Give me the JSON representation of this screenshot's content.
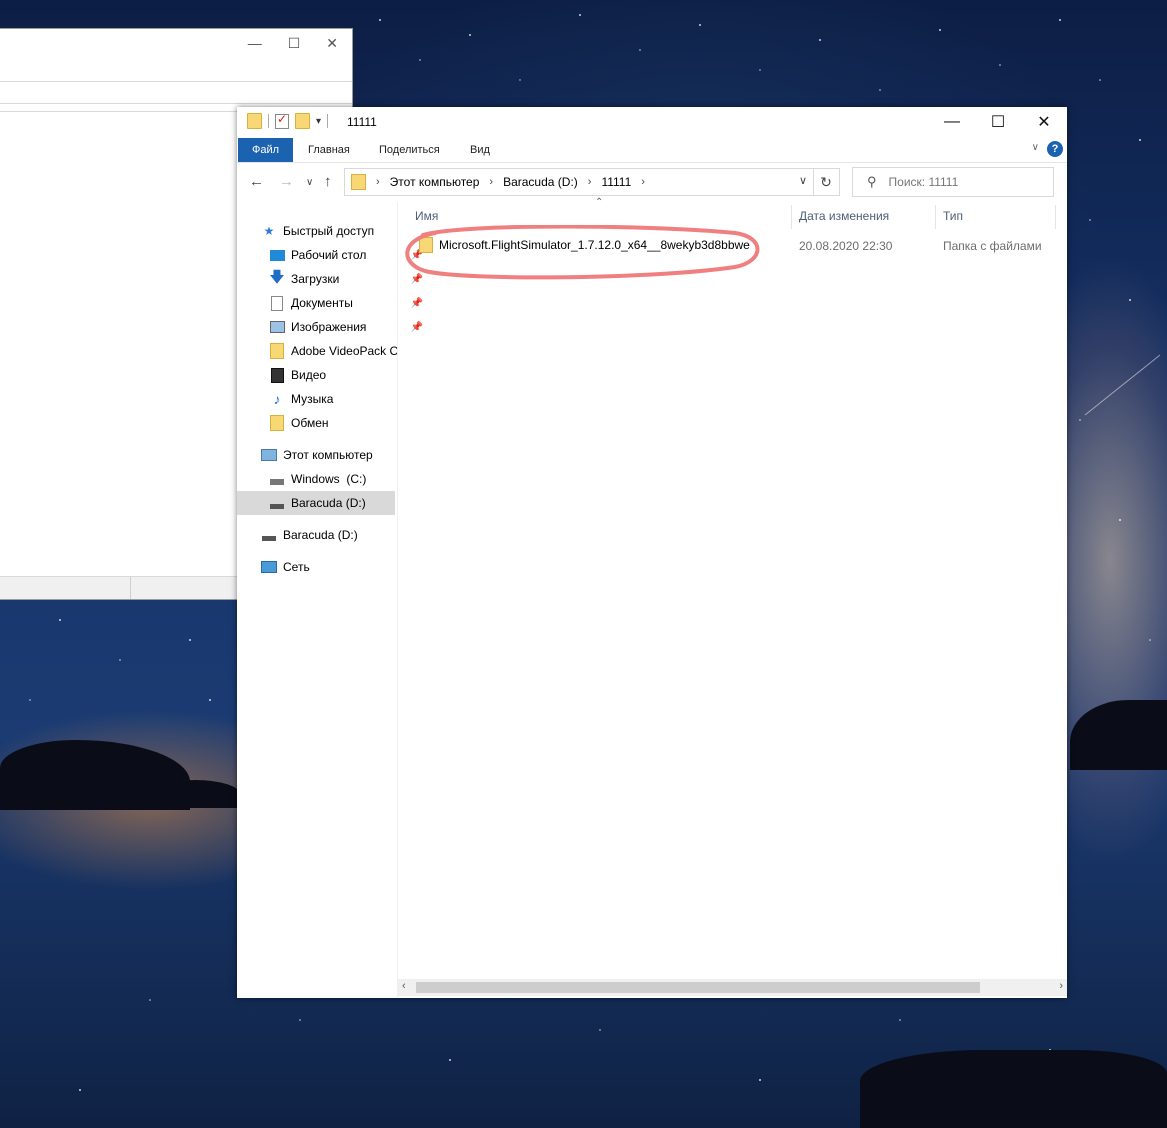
{
  "explorer": {
    "title": "11111",
    "ribbon_tabs": [
      "Файл",
      "Главная",
      "Поделиться",
      "Вид"
    ],
    "address": {
      "crumbs": [
        "Этот компьютер",
        "Baracuda (D:)",
        "11111"
      ]
    },
    "search_placeholder": "Поиск: 11111",
    "sidebar": {
      "quick_access": "Быстрый доступ",
      "items": [
        {
          "label": "Рабочий стол",
          "icon": "desktop-icon",
          "pinned": true
        },
        {
          "label": "Загрузки",
          "icon": "download-icon",
          "pinned": true
        },
        {
          "label": "Документы",
          "icon": "document-icon",
          "pinned": true
        },
        {
          "label": "Изображения",
          "icon": "pictures-icon",
          "pinned": true
        },
        {
          "label": "Adobe VideoPack C",
          "icon": "folder-icon",
          "pinned": false
        },
        {
          "label": "Видео",
          "icon": "video-icon",
          "pinned": false
        },
        {
          "label": "Музыка",
          "icon": "music-icon",
          "pinned": false
        },
        {
          "label": "Обмен",
          "icon": "folder-icon",
          "pinned": false
        }
      ],
      "this_pc": "Этот компьютер",
      "drive_c": "Windows  (C:)",
      "drive_d": "Baracuda (D:)",
      "drive_d2": "Baracuda (D:)",
      "network": "Сеть"
    },
    "columns": {
      "name": "Имя",
      "date": "Дата изменения",
      "type": "Тип"
    },
    "files": [
      {
        "name": "Microsoft.FlightSimulator_1.7.12.0_x64__8wekyb3d8bbwe",
        "date": "20.08.2020 22:30",
        "type": "Папка с файлами"
      }
    ]
  },
  "colors": {
    "file_tab": "#1b62b0",
    "highlight_ring": "#f07f7f",
    "selection": "#d9d9d9"
  }
}
